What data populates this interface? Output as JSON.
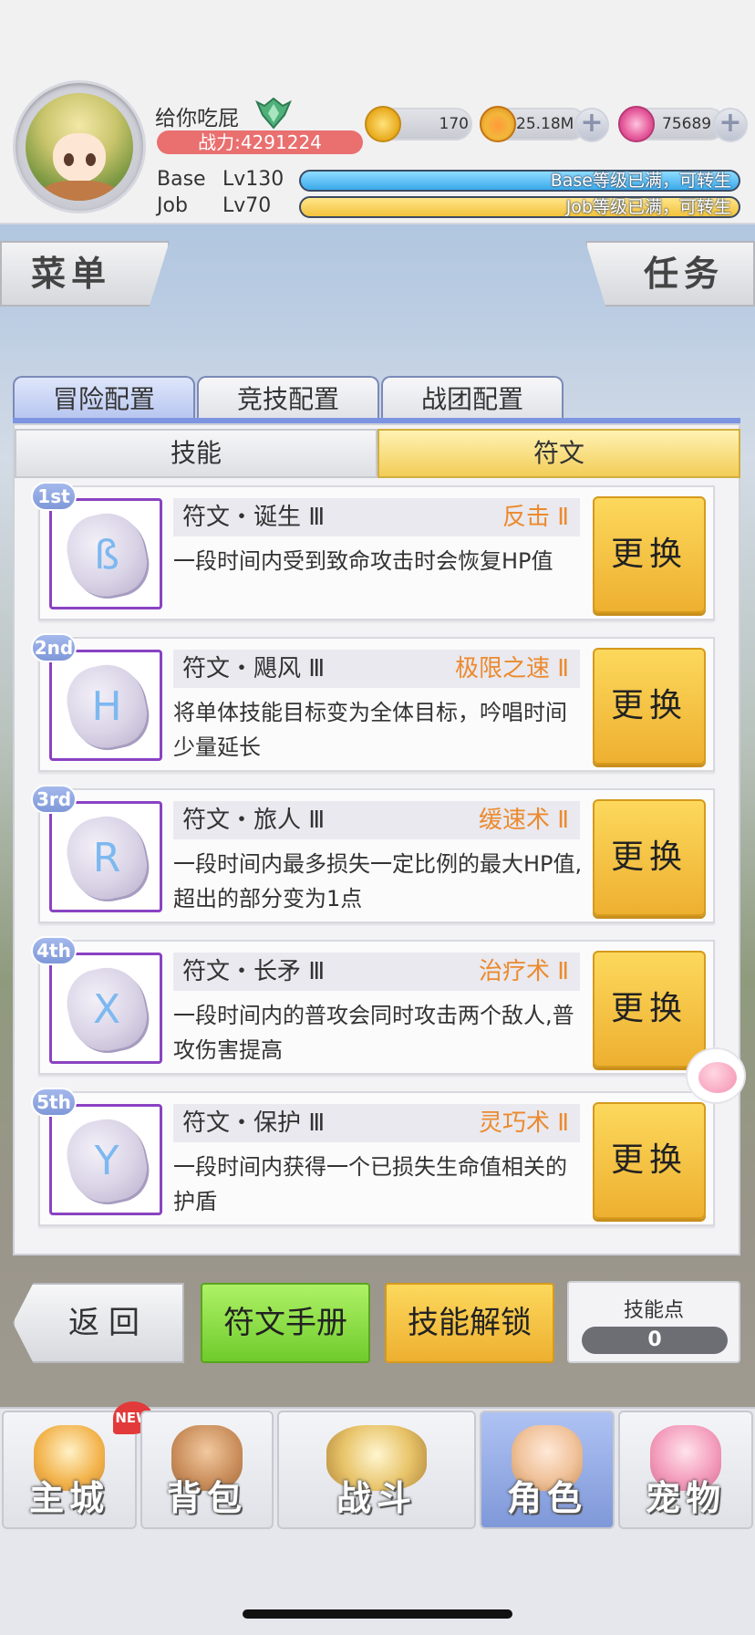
{
  "player": {
    "name": "给你吃屁",
    "power": "战力:4291224"
  },
  "currencies": [
    {
      "icon": "zeny-coin-icon",
      "value": "170"
    },
    {
      "icon": "gold-pouch-icon",
      "value": "25.18M"
    },
    {
      "icon": "pink-gem-icon",
      "value": "75689"
    }
  ],
  "levels": {
    "base": {
      "label": "Base",
      "level": "Lv130",
      "status": "Base等级已满，可转生"
    },
    "job": {
      "label": "Job",
      "level": "Lv70",
      "status": "Job等级已满，可转生"
    }
  },
  "side": {
    "menu": "菜单",
    "task": "任务"
  },
  "tabs": [
    "冒险配置",
    "竞技配置",
    "战团配置"
  ],
  "subtabs": [
    "技能",
    "符文"
  ],
  "runes": [
    {
      "order": "1st",
      "name": "符文・诞生 Ⅲ",
      "skill": "反击 Ⅱ",
      "desc": "一段时间内受到致命攻击时会恢复HP值",
      "glyph": "ß",
      "button": "更换"
    },
    {
      "order": "2nd",
      "name": "符文・飓风 Ⅲ",
      "skill": "极限之速 Ⅱ",
      "desc": "将单体技能目标变为全体目标，吟唱时间少量延长",
      "glyph": "H",
      "button": "更换"
    },
    {
      "order": "3rd",
      "name": "符文・旅人 Ⅲ",
      "skill": "缓速术 Ⅱ",
      "desc": "一段时间内最多损失一定比例的最大HP值,超出的部分变为1点",
      "glyph": "R",
      "button": "更换"
    },
    {
      "order": "4th",
      "name": "符文・长矛 Ⅲ",
      "skill": "治疗术 Ⅱ",
      "desc": "一段时间内的普攻会同时攻击两个敌人,普攻伤害提高",
      "glyph": "X",
      "button": "更换"
    },
    {
      "order": "5th",
      "name": "符文・保护 Ⅲ",
      "skill": "灵巧术 Ⅱ",
      "desc": "一段时间内获得一个已损失生命值相关的护盾",
      "glyph": "Y",
      "button": "更换"
    }
  ],
  "actions": {
    "back": "返回",
    "manual": "符文手册",
    "unlock": "技能解锁",
    "skill_points_label": "技能点",
    "skill_points": "0"
  },
  "nav": {
    "new_badge": "NEW",
    "items": [
      {
        "label": "主城",
        "icon": "castle-icon"
      },
      {
        "label": "背包",
        "icon": "backpack-icon"
      },
      {
        "label": "战斗",
        "icon": "crossed-swords-icon"
      },
      {
        "label": "角色",
        "icon": "character-icon"
      },
      {
        "label": "宠物",
        "icon": "poring-pet-icon"
      }
    ]
  },
  "colors": {
    "power": "#ea6f6f",
    "skill_name": "#ec8a2e",
    "accent_yellow": "#f2c33c",
    "accent_blue": "#7d95e0",
    "rune_frame": "#8a42c2"
  }
}
